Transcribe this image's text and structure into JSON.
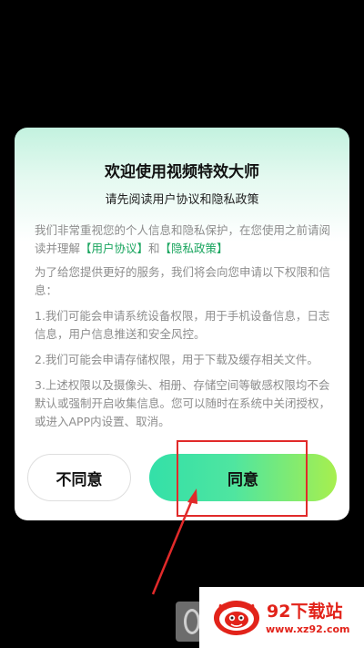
{
  "dialog": {
    "title": "欢迎使用视频特效大师",
    "subtitle": "请先阅读用户协议和隐私政策",
    "intro": "我们非常重视您的个人信息和隐私保护，在您使用之前请阅读并理解",
    "user_agreement_link": "【用户协议】",
    "and_text": "和",
    "privacy_policy_link": "【隐私政策】",
    "para2": "为了给您提供更好的服务，我们将会向您申请以下权限和信息：",
    "item1": "1.我们可能会申请系统设备权限，用于手机设备信息，日志信息，用户信息推送和安全风控。",
    "item2": "2.我们可能会申请存储权限，用于下载及缓存相关文件。",
    "item3": "3.上述权限以及摄像头、相册、存储空间等敏感权限均不会默认或强制开启收集信息。您可以随时在系统中关闭授权，或进入APP内设置、取消。",
    "decline_label": "不同意",
    "agree_label": "同意"
  },
  "watermark": {
    "name": "92下载站",
    "url": "www.xz92.com"
  },
  "colors": {
    "link": "#1aa55f",
    "highlight": "#e12a2a",
    "agree_gradient_start": "#33e0a8",
    "agree_gradient_end": "#a7ef4e"
  }
}
